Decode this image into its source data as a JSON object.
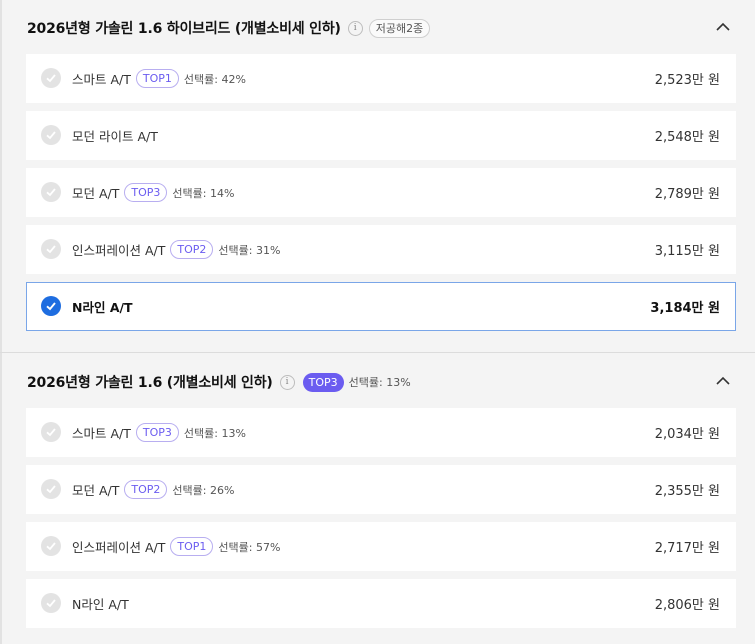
{
  "sections": [
    {
      "title": "2026년형 가솔린 1.6 하이브리드 (개별소비세 인하)",
      "info_glyph": "i",
      "badge": "저공해2종",
      "rows": [
        {
          "name": "스마트 A/T",
          "tag": "TOP1",
          "rate": "선택률: 42%",
          "price": "2,523만 원",
          "selected": false
        },
        {
          "name": "모던 라이트 A/T",
          "tag": "",
          "rate": "",
          "price": "2,548만 원",
          "selected": false
        },
        {
          "name": "모던 A/T",
          "tag": "TOP3",
          "rate": "선택률: 14%",
          "price": "2,789만 원",
          "selected": false
        },
        {
          "name": "인스퍼레이션 A/T",
          "tag": "TOP2",
          "rate": "선택률: 31%",
          "price": "3,115만 원",
          "selected": false
        },
        {
          "name": "N라인 A/T",
          "tag": "",
          "rate": "",
          "price": "3,184만 원",
          "selected": true
        }
      ]
    },
    {
      "title": "2026년형 가솔린 1.6 (개별소비세 인하)",
      "info_glyph": "i",
      "top_tag": "TOP3",
      "top_rate": "선택률: 13%",
      "rows": [
        {
          "name": "스마트 A/T",
          "tag": "TOP3",
          "rate": "선택률: 13%",
          "price": "2,034만 원",
          "selected": false
        },
        {
          "name": "모던 A/T",
          "tag": "TOP2",
          "rate": "선택률: 26%",
          "price": "2,355만 원",
          "selected": false
        },
        {
          "name": "인스퍼레이션 A/T",
          "tag": "TOP1",
          "rate": "선택률: 57%",
          "price": "2,717만 원",
          "selected": false
        },
        {
          "name": "N라인 A/T",
          "tag": "",
          "rate": "",
          "price": "2,806만 원",
          "selected": false
        }
      ]
    }
  ],
  "colors": {
    "accent": "#6b5cf0",
    "selected_check": "#1e6de0",
    "selected_border": "#7aa6e8",
    "unselected_check": "#e3e3e3"
  },
  "icons": {
    "collapse": "chevron-up-icon",
    "info": "info-icon",
    "check": "check-icon"
  }
}
